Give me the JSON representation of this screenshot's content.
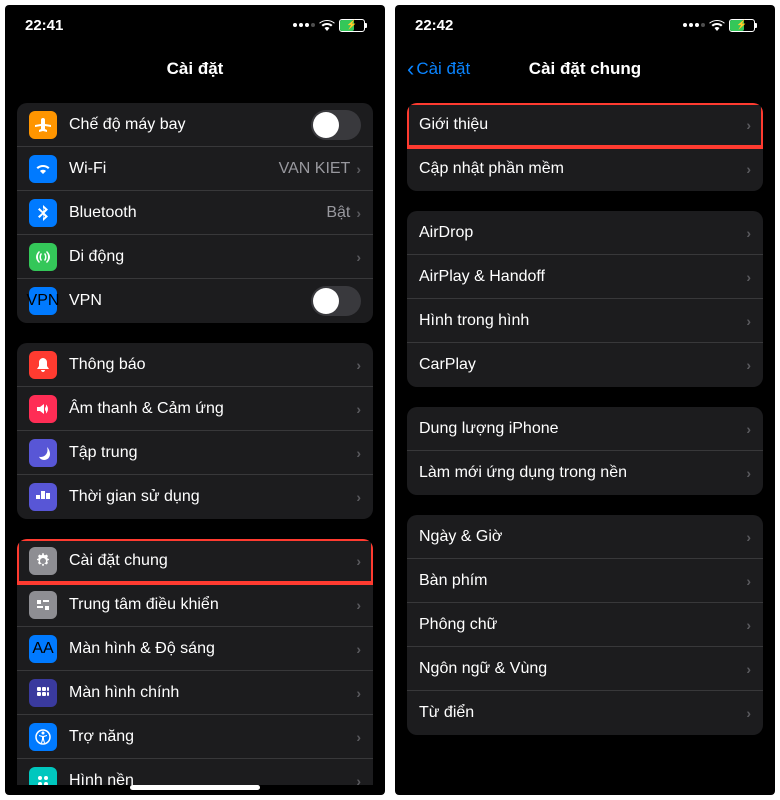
{
  "left": {
    "time": "22:41",
    "title": "Cài đặt",
    "sections": [
      {
        "rows": [
          {
            "icon": "airplane",
            "bg": "#ff9500",
            "label": "Chế độ máy bay",
            "control": "toggle",
            "on": false
          },
          {
            "icon": "wifi",
            "bg": "#007aff",
            "label": "Wi-Fi",
            "detail": "VAN KIET",
            "control": "chevron"
          },
          {
            "icon": "bluetooth",
            "bg": "#007aff",
            "label": "Bluetooth",
            "detail": "Bật",
            "control": "chevron"
          },
          {
            "icon": "cellular",
            "bg": "#34c759",
            "label": "Di động",
            "control": "chevron"
          },
          {
            "icon": "vpn",
            "bg": "#007aff",
            "label": "VPN",
            "control": "toggle",
            "on": false
          }
        ]
      },
      {
        "rows": [
          {
            "icon": "notification",
            "bg": "#ff3b30",
            "label": "Thông báo",
            "control": "chevron"
          },
          {
            "icon": "sound",
            "bg": "#ff2d55",
            "label": "Âm thanh & Cảm ứng",
            "control": "chevron"
          },
          {
            "icon": "focus",
            "bg": "#5856d6",
            "label": "Tập trung",
            "control": "chevron"
          },
          {
            "icon": "screentime",
            "bg": "#5856d6",
            "label": "Thời gian sử dụng",
            "control": "chevron"
          }
        ]
      },
      {
        "rows": [
          {
            "icon": "gear",
            "bg": "#8e8e93",
            "label": "Cài đặt chung",
            "control": "chevron",
            "highlighted": true
          },
          {
            "icon": "control",
            "bg": "#8e8e93",
            "label": "Trung tâm điều khiển",
            "control": "chevron"
          },
          {
            "icon": "display",
            "bg": "#007aff",
            "label": "Màn hình & Độ sáng",
            "control": "chevron"
          },
          {
            "icon": "home",
            "bg": "#3a3a9e",
            "label": "Màn hình chính",
            "control": "chevron"
          },
          {
            "icon": "accessibility",
            "bg": "#007aff",
            "label": "Trợ năng",
            "control": "chevron"
          },
          {
            "icon": "wallpaper",
            "bg": "#00c7be",
            "label": "Hình nền",
            "control": "chevron"
          }
        ]
      }
    ]
  },
  "right": {
    "time": "22:42",
    "back": "Cài đặt",
    "title": "Cài đặt chung",
    "sections": [
      {
        "rows": [
          {
            "label": "Giới thiệu",
            "control": "chevron",
            "highlighted": true
          },
          {
            "label": "Cập nhật phần mềm",
            "control": "chevron"
          }
        ]
      },
      {
        "rows": [
          {
            "label": "AirDrop",
            "control": "chevron"
          },
          {
            "label": "AirPlay & Handoff",
            "control": "chevron"
          },
          {
            "label": "Hình trong hình",
            "control": "chevron"
          },
          {
            "label": "CarPlay",
            "control": "chevron"
          }
        ]
      },
      {
        "rows": [
          {
            "label": "Dung lượng iPhone",
            "control": "chevron"
          },
          {
            "label": "Làm mới ứng dụng trong nền",
            "control": "chevron"
          }
        ]
      },
      {
        "rows": [
          {
            "label": "Ngày & Giờ",
            "control": "chevron"
          },
          {
            "label": "Bàn phím",
            "control": "chevron"
          },
          {
            "label": "Phông chữ",
            "control": "chevron"
          },
          {
            "label": "Ngôn ngữ & Vùng",
            "control": "chevron"
          },
          {
            "label": "Từ điển",
            "control": "chevron"
          }
        ]
      }
    ]
  }
}
